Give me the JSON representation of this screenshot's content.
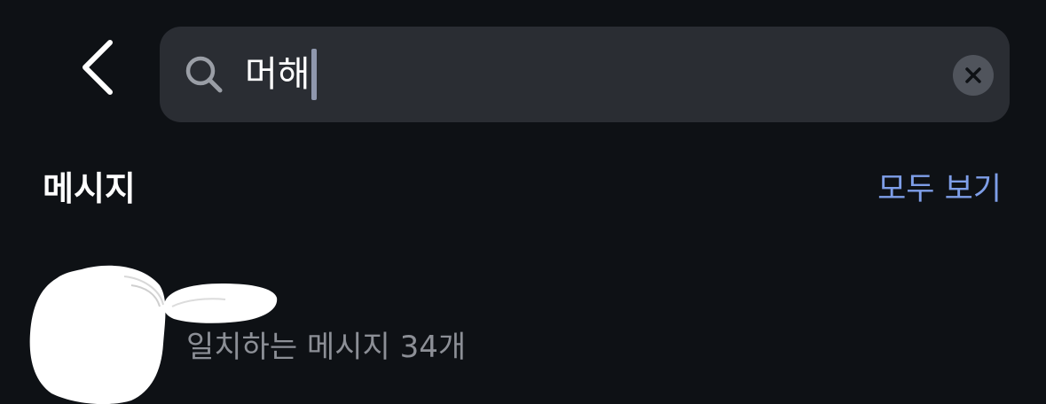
{
  "header": {
    "back_icon": "chevron-left-icon",
    "search": {
      "icon": "search-icon",
      "value": "머해",
      "clear_icon": "close-icon"
    }
  },
  "messages_section": {
    "title": "메시지",
    "see_all_label": "모두 보기",
    "results": [
      {
        "avatar": "redacted",
        "name": "",
        "subtitle": "일치하는 메시지 34개"
      }
    ]
  },
  "colors": {
    "background": "#0e1115",
    "search_field": "#2a2d33",
    "accent_link": "#7e9ee8",
    "secondary_text": "#8c8f96",
    "clear_button": "#50545c",
    "caret": "#8f97ad"
  }
}
